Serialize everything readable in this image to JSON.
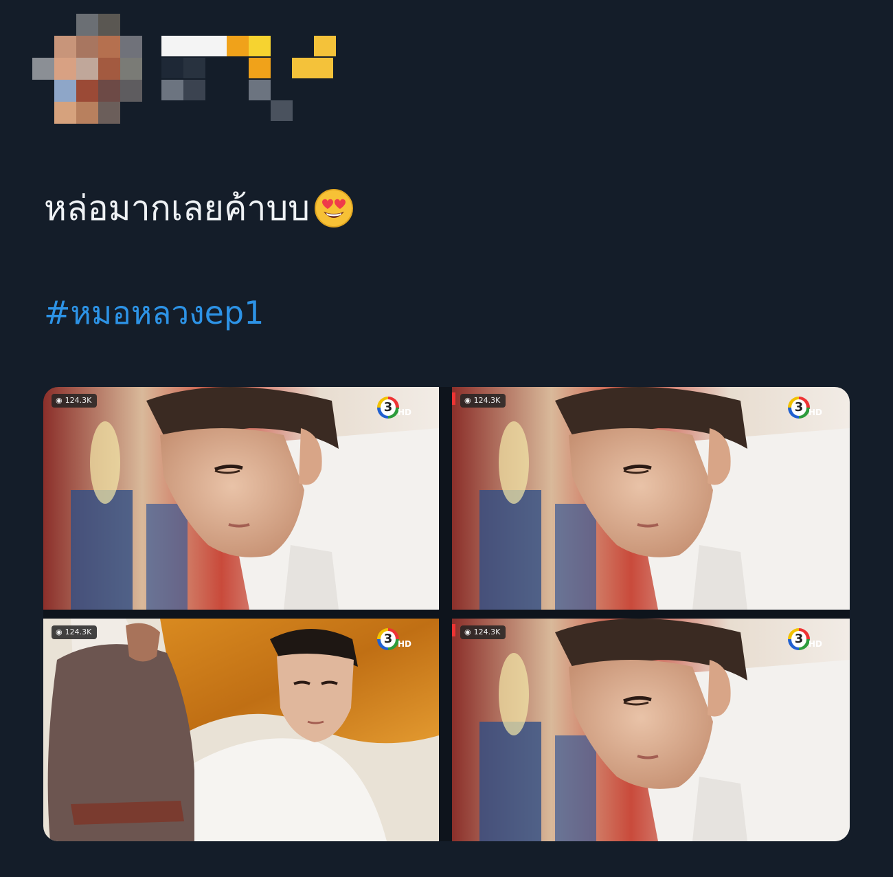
{
  "tweet": {
    "text": "หล่อมากเลยค้าบบ",
    "emoji": "smiling-face-with-heart-eyes",
    "hashtag": "#หมอหลวงep1"
  },
  "media": {
    "images": [
      {
        "views": "124.3K",
        "scene": "close-up-man-white-shirt",
        "channel": "3",
        "channel_suffix": "HD"
      },
      {
        "views": "124.3K",
        "scene": "close-up-man-white-shirt",
        "channel": "3",
        "channel_suffix": "HD"
      },
      {
        "views": "124.3K",
        "scene": "man-white-shirt-with-woman-orange-curtain",
        "channel": "3",
        "channel_suffix": "HD"
      },
      {
        "views": "124.3K",
        "scene": "close-up-man-white-shirt",
        "channel": "3",
        "channel_suffix": "HD"
      }
    ]
  },
  "colors": {
    "background": "#141d29",
    "text": "#eef1f4",
    "hashtag": "#2d93e6"
  }
}
